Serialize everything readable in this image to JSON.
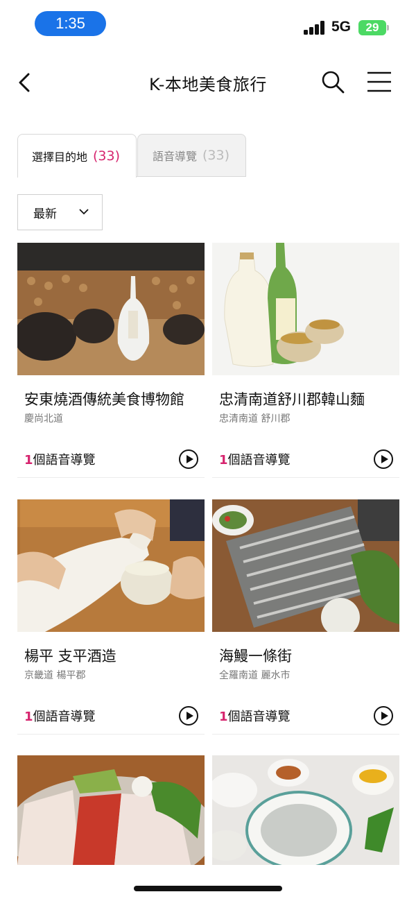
{
  "status_bar": {
    "time": "1:35",
    "network": "5G",
    "battery": "29"
  },
  "header": {
    "title": "K-本地美食旅行"
  },
  "tabs": [
    {
      "label": "選擇目的地",
      "count": "(33)"
    },
    {
      "label": "語音導覽",
      "count": "(33)"
    }
  ],
  "sort": {
    "value": "最新"
  },
  "cards": [
    {
      "name": "安東燒酒傳統美食博物館",
      "region": "慶尚北道",
      "guide_count": "1",
      "guide_label": "個語音導覽"
    },
    {
      "name": "忠清南道舒川郡韓山麵",
      "region": "忠清南道 舒川郡",
      "guide_count": "1",
      "guide_label": "個語音導覽"
    },
    {
      "name": "楊平 支平酒造",
      "region": "京畿道 楊平郡",
      "guide_count": "1",
      "guide_label": "個語音導覽"
    },
    {
      "name": "海鰻一條街",
      "region": "全羅南道 麗水市",
      "guide_count": "1",
      "guide_label": "個語音導覽"
    }
  ],
  "colors": {
    "accent": "#d6246e",
    "time_pill": "#1a73e8",
    "battery": "#4cd964"
  },
  "icons": [
    "back-chevron-icon",
    "search-icon",
    "menu-icon",
    "chevron-down-icon",
    "play-icon"
  ]
}
